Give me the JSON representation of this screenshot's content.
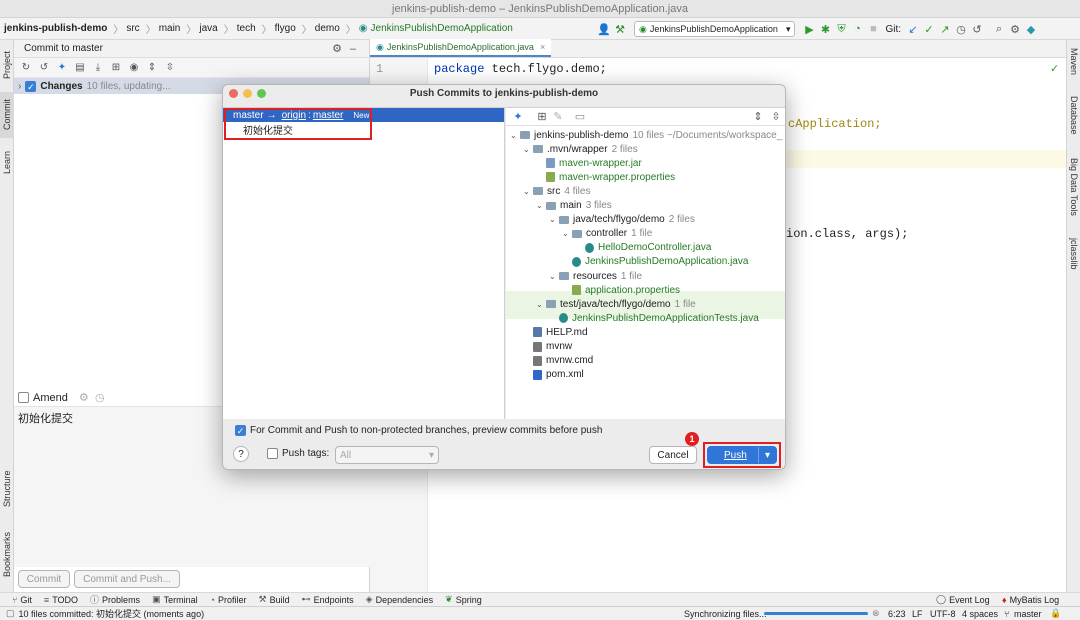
{
  "window": {
    "title": "jenkins-publish-demo – JenkinsPublishDemoApplication.java"
  },
  "breadcrumb": [
    "jenkins-publish-demo",
    "src",
    "main",
    "java",
    "tech",
    "flygo",
    "demo",
    "JenkinsPublishDemoApplication"
  ],
  "toolbar": {
    "run_config": "JenkinsPublishDemoApplication",
    "git_label": "Git:"
  },
  "left_tabs": {
    "project": "Project",
    "commit": "Commit",
    "learn": "Learn",
    "structure": "Structure",
    "bookmarks": "Bookmarks"
  },
  "right_tabs": {
    "maven": "Maven",
    "database": "Database",
    "big_data": "Big Data Tools",
    "jclasslib": "jclasslib"
  },
  "commit_panel": {
    "header": "Commit to master",
    "changes_label": "Changes",
    "changes_info": "10 files, updating...",
    "amend_label": "Amend",
    "message": "初始化提交",
    "commit_btn": "Commit",
    "commit_push_btn": "Commit and Push..."
  },
  "editor": {
    "tab": "JenkinsPublishDemoApplication.java",
    "line_no": "1",
    "code_kw": "package",
    "code_pkg": "tech.flygo.demo;",
    "frag1": "cApplication;",
    "frag2": "ion.class, args);"
  },
  "dialog": {
    "title": "Push Commits to jenkins-publish-demo",
    "branch_from": "master",
    "arrow": "→",
    "remote": "origin",
    "colon": ":",
    "branch_to": "master",
    "new_badge": "New",
    "commit_msg": "初始化提交",
    "tree": [
      {
        "label": "jenkins-publish-demo",
        "count": "10 files  ~/Documents/workspace_",
        "kind": "folder",
        "lvl": 0
      },
      {
        "label": ".mvn/wrapper",
        "count": "2 files",
        "kind": "folder",
        "lvl": 1
      },
      {
        "label": "maven-wrapper.jar",
        "count": "",
        "kind": "file",
        "lvl": 2
      },
      {
        "label": "maven-wrapper.properties",
        "count": "",
        "kind": "file",
        "lvl": 2
      },
      {
        "label": "src",
        "count": "4 files",
        "kind": "folder",
        "lvl": 1
      },
      {
        "label": "main",
        "count": "3 files",
        "kind": "folder",
        "lvl": 2
      },
      {
        "label": "java/tech/flygo/demo",
        "count": "2 files",
        "kind": "folder",
        "lvl": 3
      },
      {
        "label": "controller",
        "count": "1 file",
        "kind": "folder",
        "lvl": 4
      },
      {
        "label": "HelloDemoController.java",
        "count": "",
        "kind": "file",
        "lvl": 5
      },
      {
        "label": "JenkinsPublishDemoApplication.java",
        "count": "",
        "kind": "file",
        "lvl": 4
      },
      {
        "label": "resources",
        "count": "1 file",
        "kind": "folder",
        "lvl": 3
      },
      {
        "label": "application.properties",
        "count": "",
        "kind": "file",
        "lvl": 4
      },
      {
        "label": "test/java/tech/flygo/demo",
        "count": "1 file",
        "kind": "folder",
        "lvl": 2
      },
      {
        "label": "JenkinsPublishDemoApplicationTests.java",
        "count": "",
        "kind": "file",
        "lvl": 3
      },
      {
        "label": "HELP.md",
        "count": "",
        "kind": "plain",
        "lvl": 1
      },
      {
        "label": "mvnw",
        "count": "",
        "kind": "plain",
        "lvl": 1
      },
      {
        "label": "mvnw.cmd",
        "count": "",
        "kind": "plain",
        "lvl": 1
      },
      {
        "label": "pom.xml",
        "count": "",
        "kind": "plain",
        "lvl": 1
      }
    ],
    "preview_label": "For Commit and Push to non-protected branches, preview commits before push",
    "help": "?",
    "push_tags_label": "Push tags:",
    "tags_value": "All",
    "cancel": "Cancel",
    "push": "Push",
    "step_badge": "1"
  },
  "toolwindows": [
    "Git",
    "TODO",
    "Problems",
    "Terminal",
    "Profiler",
    "Build",
    "Endpoints",
    "Dependencies",
    "Spring"
  ],
  "toolwindows_right": {
    "event_log": "Event Log",
    "mybatis_log": "MyBatis Log"
  },
  "status": {
    "message": "10 files committed: 初始化提交 (moments ago)",
    "sync": "Synchronizing files...",
    "pos": "6:23",
    "lf": "LF",
    "enc": "UTF-8",
    "indent": "4 spaces",
    "branch": "master"
  }
}
